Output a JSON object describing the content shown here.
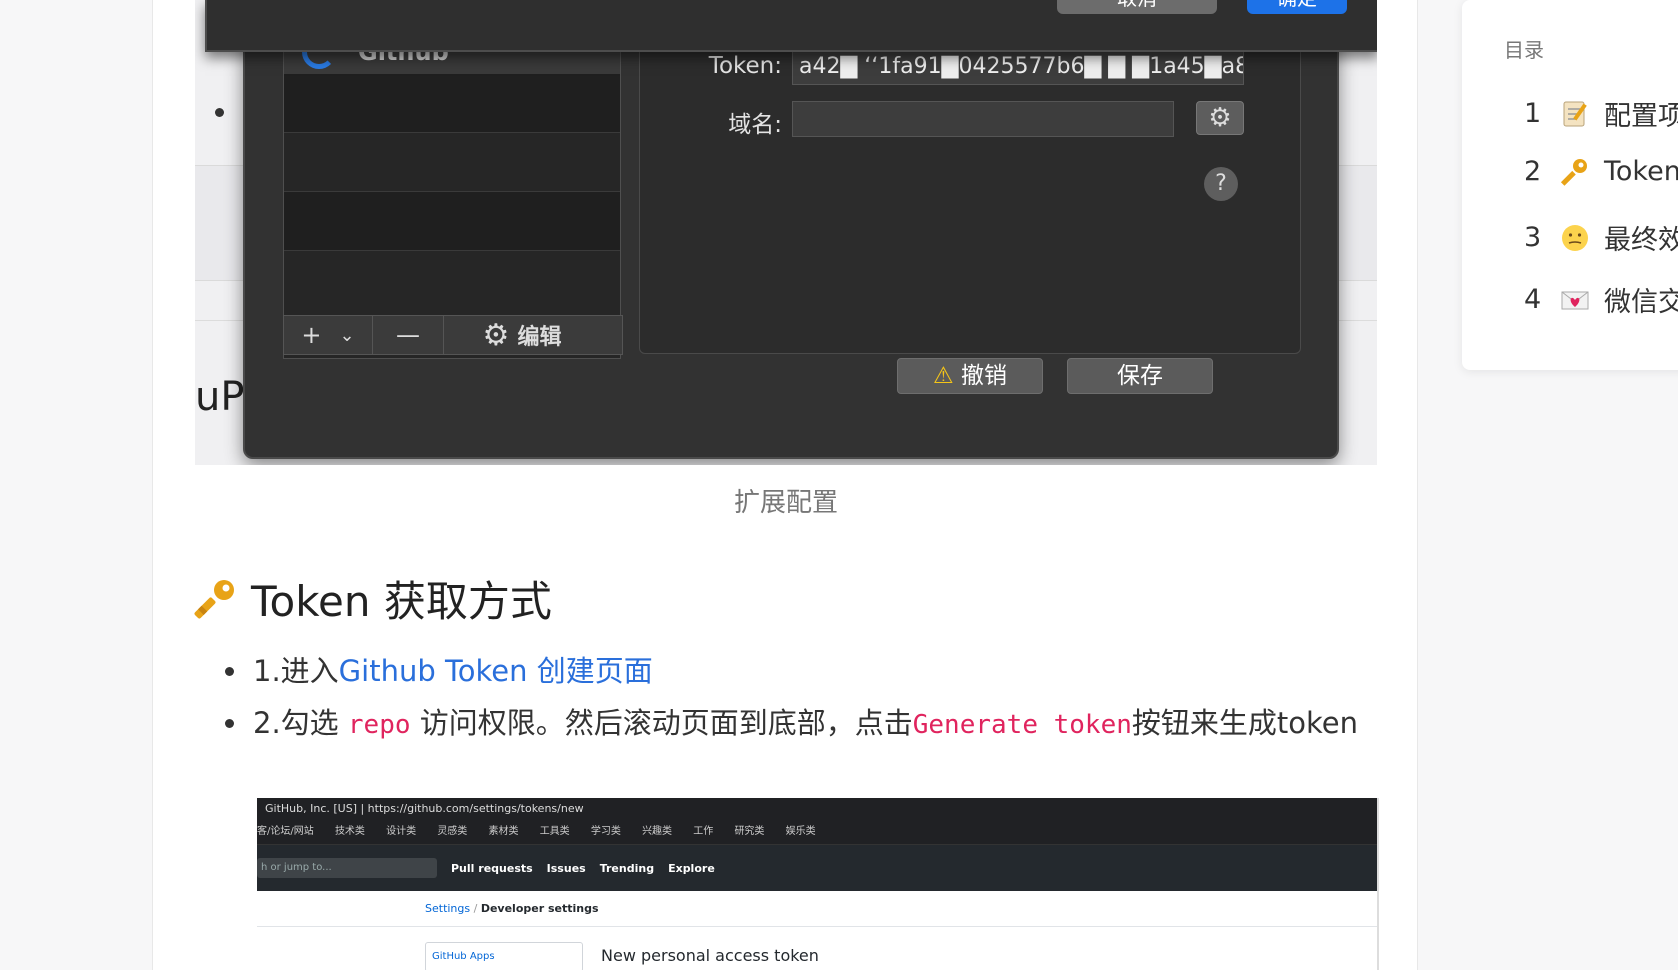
{
  "dialog": {
    "top_cancel": "取消",
    "top_ok": "确定",
    "list_selected": "Github",
    "token_label": "Token:",
    "token_value": "a42▇ ‘‘1fa91▇0425577b6▇ ▇ ▇1a45▇a8...",
    "domain_label": "域名:",
    "domain_value": "",
    "add_symbol": "+",
    "dropdown_symbol": "⌄",
    "remove_symbol": "—",
    "edit_label": "编辑",
    "help_symbol": "?",
    "revert_label": "撤销",
    "save_label": "保存"
  },
  "caption": "扩展配置",
  "background_text": "uP",
  "section": {
    "heading": "Token 获取方式",
    "heading_icon": "key-icon",
    "step1_prefix": "1.进入",
    "step1_link": "Github Token 创建页面",
    "step2_a": "2.勾选 ",
    "step2_code1": "repo",
    "step2_b": " 访问权限。然后滚动页面到底部，点击",
    "step2_code2": "Generate token",
    "step2_c": "按钮来生成token"
  },
  "github": {
    "url_bar": "GitHub, Inc. [US]  |  https://github.com/settings/tokens/new",
    "bookmarks": [
      "客/论坛/网站",
      "技术类",
      "设计类",
      "灵感类",
      "素材类",
      "工具类",
      "学习类",
      "兴趣类",
      "工作",
      "研究类",
      "娱乐类"
    ],
    "search_placeholder": "h or jump to...",
    "nav": [
      "Pull requests",
      "Issues",
      "Trending",
      "Explore"
    ],
    "crumb_settings": "Settings",
    "crumb_sep": " / ",
    "crumb_dev": "Developer settings",
    "side_apps": "GitHub Apps",
    "page_title": "New personal access token"
  },
  "toc": {
    "title": "目录",
    "items": [
      {
        "num": "1",
        "icon": "memo-icon",
        "label": "配置项"
      },
      {
        "num": "2",
        "icon": "key-icon",
        "label": "Token"
      },
      {
        "num": "3",
        "icon": "face-icon",
        "label": "最终效"
      },
      {
        "num": "4",
        "icon": "love-letter-icon",
        "label": "微信交"
      }
    ]
  }
}
